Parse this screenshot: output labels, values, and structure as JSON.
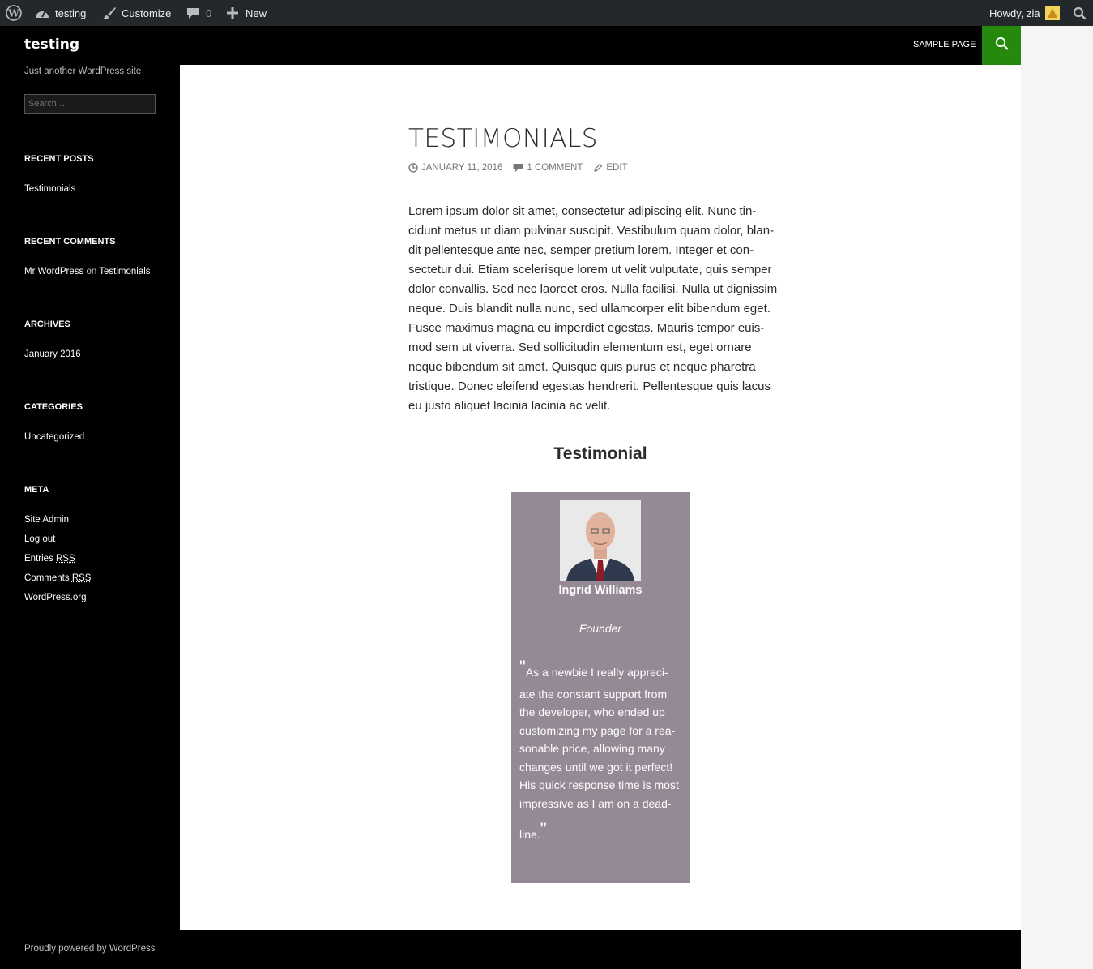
{
  "adminbar": {
    "site_name": "testing",
    "customize": "Customize",
    "comments_count": "0",
    "new": "New",
    "howdy": "Howdy, zia"
  },
  "header": {
    "site_title": "testing",
    "nav_item": "SAMPLE PAGE"
  },
  "sidebar": {
    "tagline": "Just another WordPress site",
    "search_placeholder": "Search …",
    "recent_posts_title": "RECENT POSTS",
    "recent_posts": [
      "Testimonials"
    ],
    "recent_comments_title": "RECENT COMMENTS",
    "recent_comment": {
      "author": "Mr WordPress",
      "on": "on",
      "post": "Testimonials"
    },
    "archives_title": "ARCHIVES",
    "archives": [
      "January 2016"
    ],
    "categories_title": "CATEGORIES",
    "categories": [
      "Uncategorized"
    ],
    "meta_title": "META",
    "meta": {
      "site_admin": "Site Admin",
      "log_out": "Log out",
      "entries": "Entries",
      "comments": "Comments",
      "rss": "RSS",
      "wordpress_org": "WordPress.org"
    }
  },
  "post": {
    "title": "TESTIMONIALS",
    "date": "JANUARY 11, 2016",
    "comments": "1 COMMENT",
    "edit": "EDIT",
    "body_lines": [
      "Lorem ipsum dolor sit amet, consectetur adipiscing elit. Nunc tin-",
      "cidunt metus ut diam pulvinar suscipit. Vestibulum quam dolor, blan-",
      "dit pellentesque ante nec, semper pretium lorem. Integer et con-",
      "sectetur dui. Etiam scelerisque lorem ut velit vulputate, quis semper",
      "dolor convallis. Sed nec laoreet eros. Nulla facilisi. Nulla ut dignissim",
      "neque. Duis blandit nulla nunc, sed ullamcorper elit bibendum eget.",
      "Fusce maximus magna eu imperdiet egestas. Mauris tempor euis-",
      "mod sem ut viverra. Sed sollicitudin elementum est, eget ornare",
      "neque bibendum sit amet. Quisque quis purus et neque pharetra",
      "tristique. Donec eleifend egestas hendrerit. Pellentesque quis lacus",
      "eu justo aliquet lacinia lacinia ac velit."
    ],
    "testimonial_heading": "Testimonial"
  },
  "testimonial": {
    "name": "Ingrid Williams",
    "role": "Founder",
    "open_quote": "\"",
    "close_quote": "\"",
    "quote_lines": [
      "As a newbie I really appreci-",
      "ate the constant support from",
      "the developer, who ended up",
      "customizing my page for a rea-",
      "sonable price, allowing many",
      "changes until we got it perfect!",
      "His quick response time is most",
      "impressive as I am on a dead-",
      "line."
    ],
    "card_color": "#948995"
  },
  "footer": {
    "credit": "Proudly powered by WordPress"
  },
  "colors": {
    "accent": "#24890d",
    "adminbar": "#23282d"
  }
}
